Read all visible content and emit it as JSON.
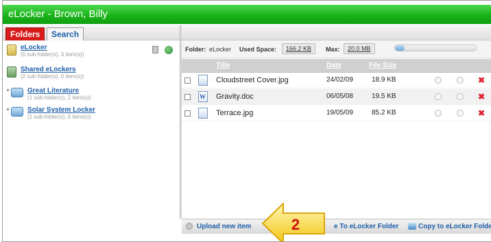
{
  "window": {
    "title": "eLocker - Brown, Billy"
  },
  "tabs": [
    {
      "label": "Folders",
      "active": true
    },
    {
      "label": "Search",
      "active": false
    }
  ],
  "lockers": [
    {
      "name": "eLocker",
      "info": "(0 sub-folder(s), 3 item(s))",
      "icon": "locker-icon"
    },
    {
      "name": "Shared eLockers",
      "info": "(2 sub-folder(s), 0 item(s))",
      "icon": "shared-locker-icon"
    },
    {
      "name": "Great Literature",
      "info": "(1 sub-folder(s), 2 item(s))",
      "icon": "folder-icon"
    },
    {
      "name": "Solar System Locker",
      "info": "(1 sub-folder(s), 0 item(s))",
      "icon": "folder-icon"
    }
  ],
  "toolbar": {
    "folder_label": "Folder:",
    "folder_name": "eLocker",
    "used_label": "Used Space:",
    "used_value": "166.2 KB",
    "max_label": "Max:",
    "max_value": "20.0 MB",
    "usage_percent": 1
  },
  "table": {
    "headers": {
      "title": "Title",
      "date": "Date",
      "size": "File Size"
    },
    "rows": [
      {
        "title": "Cloudstreet Cover.jpg",
        "date": "24/02/09",
        "size": "18.9 KB",
        "icon": "image-file-icon"
      },
      {
        "title": "Gravity.doc",
        "date": "06/05/08",
        "size": "19.5 KB",
        "icon": "word-doc-icon"
      },
      {
        "title": "Terrace.jpg",
        "date": "19/05/09",
        "size": "85.2 KB",
        "icon": "image-file-icon"
      }
    ]
  },
  "bottom": {
    "upload_label": "Upload new item",
    "move_label": "e To eLocker Folder",
    "copy_label": "Copy to eLocker Folder"
  },
  "callout": {
    "number": "2"
  },
  "colors": {
    "titlebar": "#19b419",
    "active_tab": "#d71a1a",
    "link": "#1f5fa8",
    "delete": "#dd2233"
  }
}
